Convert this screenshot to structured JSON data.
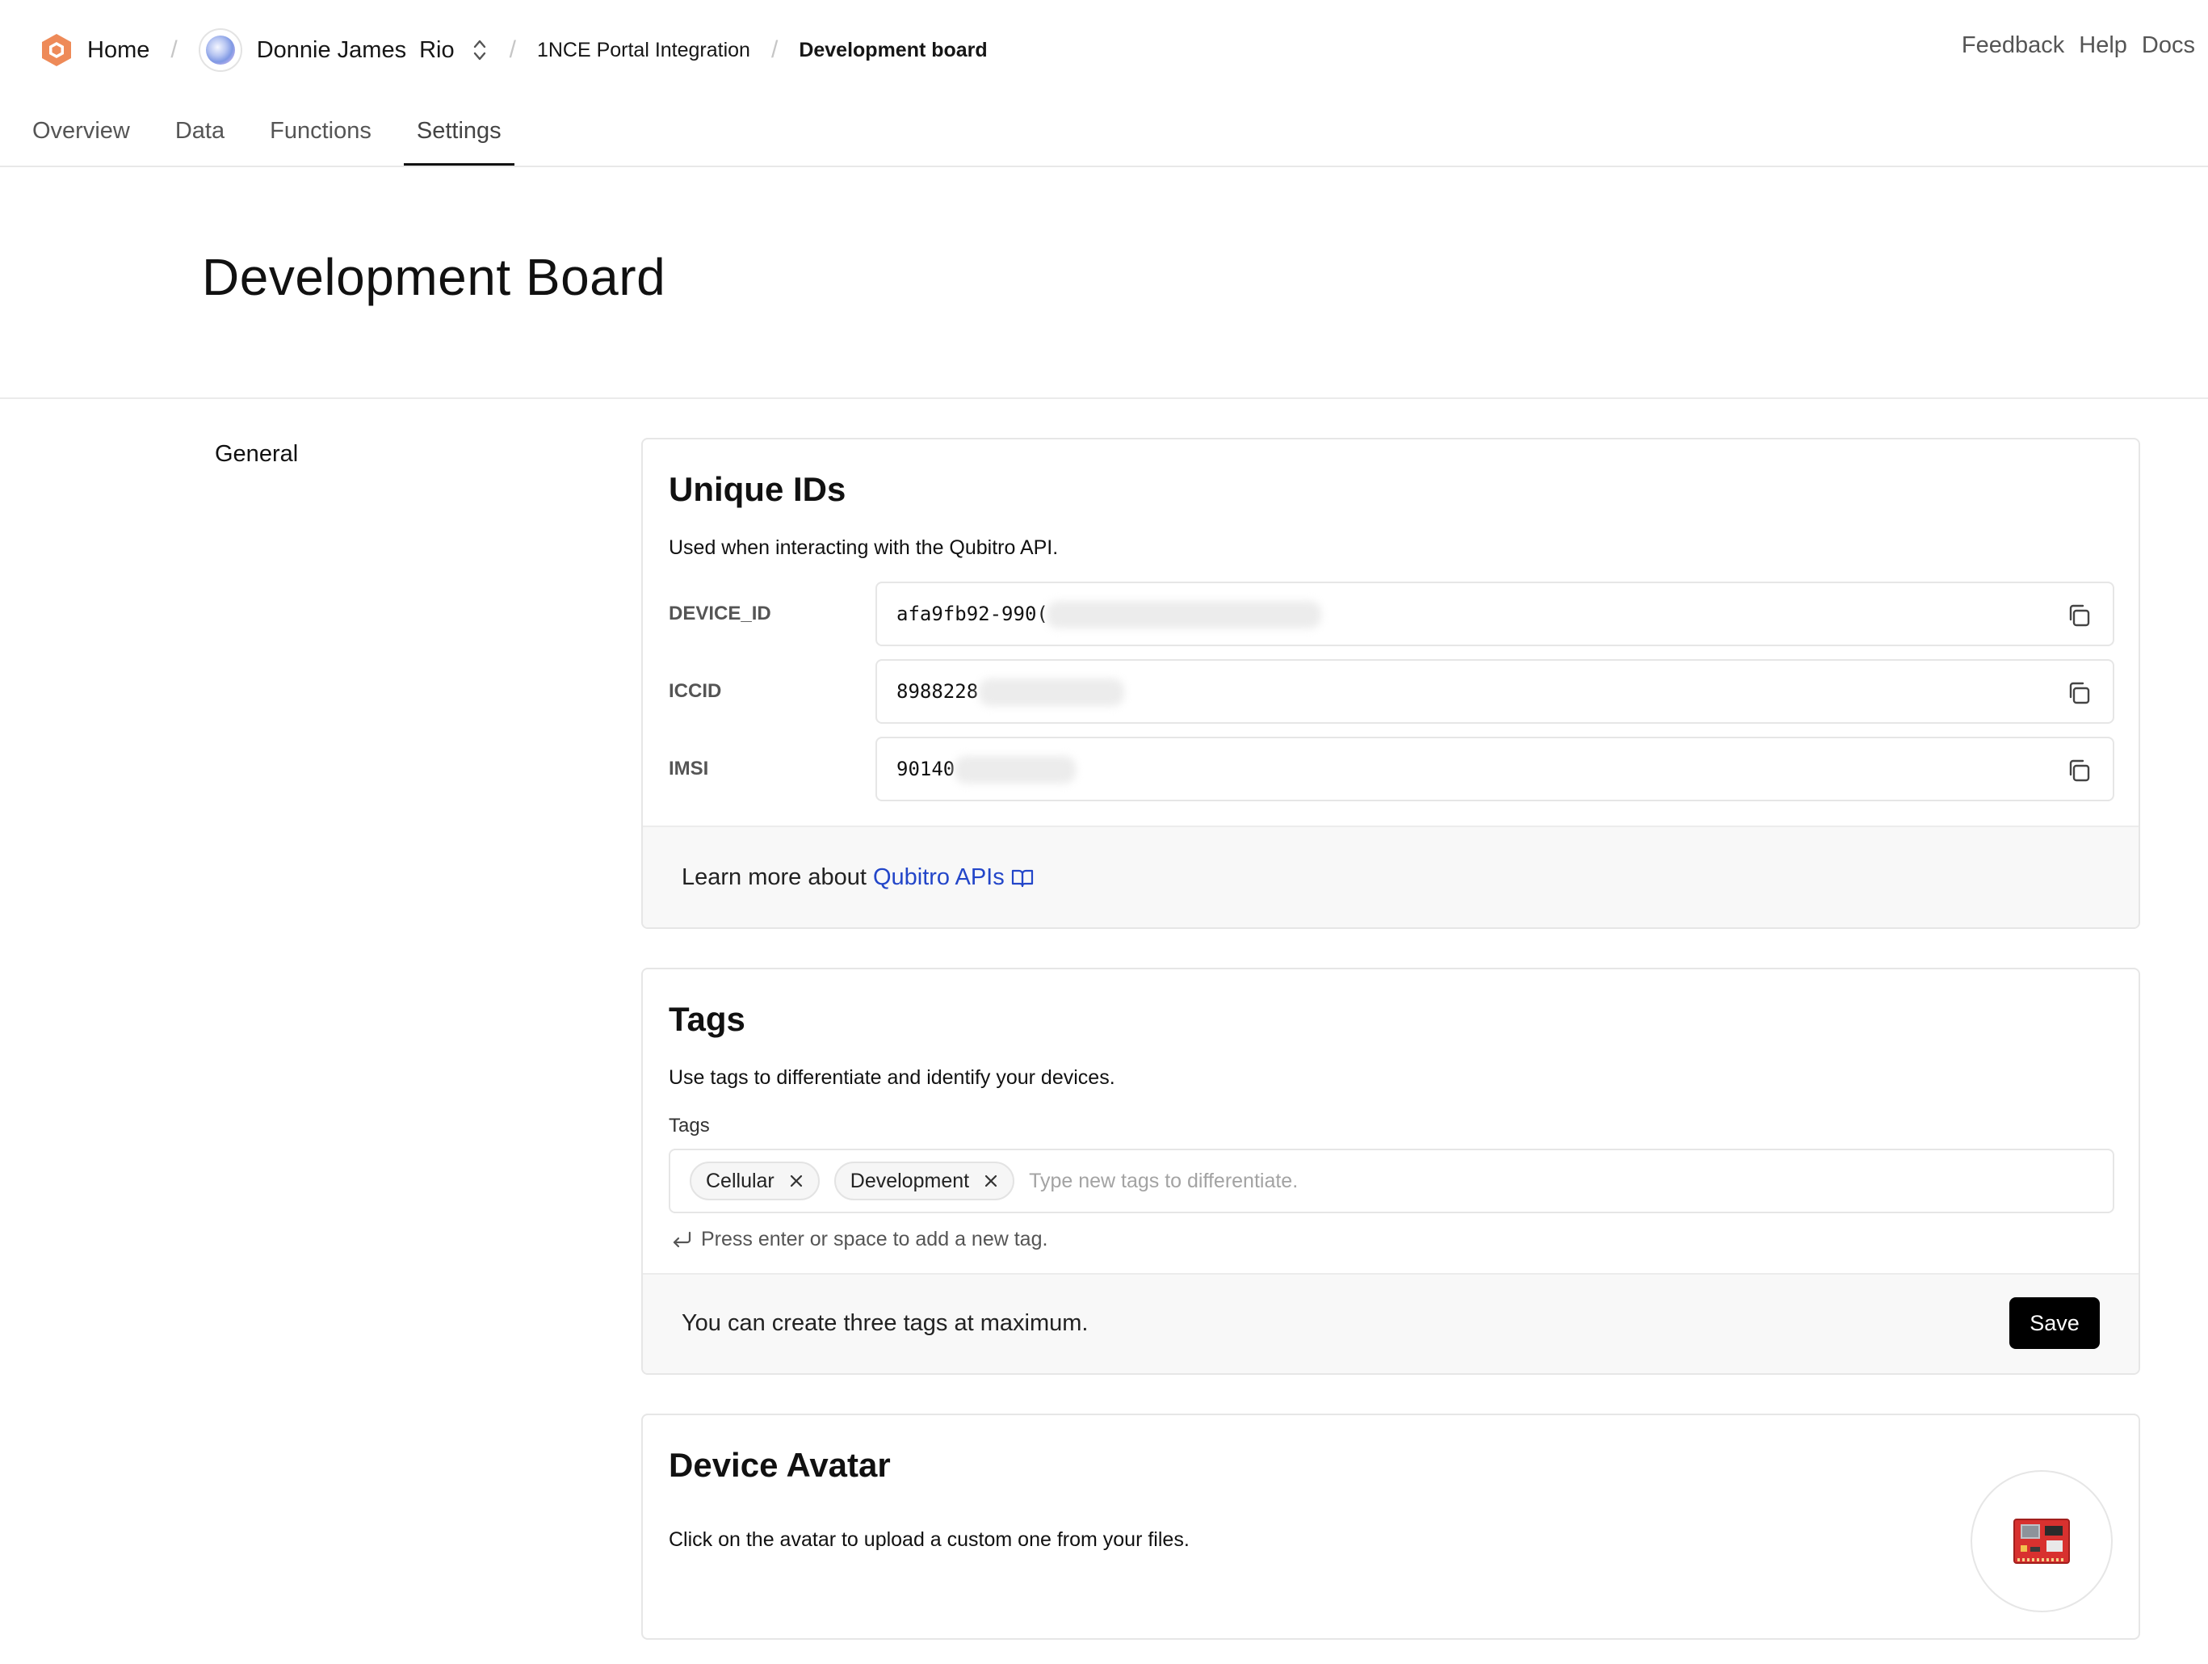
{
  "breadcrumb": {
    "home": "Home",
    "org": "Donnie James",
    "project": "Rio",
    "integration": "1NCE Portal Integration",
    "device": "Development board"
  },
  "top_links": [
    "Feedback",
    "Help",
    "Docs"
  ],
  "tabs": [
    {
      "label": "Overview"
    },
    {
      "label": "Data"
    },
    {
      "label": "Functions"
    },
    {
      "label": "Settings",
      "active": true
    }
  ],
  "page_title": "Development Board",
  "side_nav": {
    "general": "General"
  },
  "unique_ids": {
    "title": "Unique IDs",
    "description": "Used when interacting with the Qubitro API.",
    "rows": [
      {
        "label": "DEVICE_ID",
        "value": "afa9fb92-990("
      },
      {
        "label": "ICCID",
        "value": "8988228"
      },
      {
        "label": "IMSI",
        "value": "90140"
      }
    ],
    "footer_prefix": "Learn more about",
    "footer_link": "Qubitro APIs"
  },
  "tags": {
    "title": "Tags",
    "description": "Use tags to differentiate and identify your devices.",
    "field_label": "Tags",
    "chips": [
      "Cellular",
      "Development"
    ],
    "placeholder": "Type new tags to differentiate.",
    "hint": "Press enter or space to add a new tag.",
    "footer_text": "You can create three tags at maximum.",
    "save_label": "Save"
  },
  "device_avatar": {
    "title": "Device Avatar",
    "description": "Click on the avatar to upload a custom one from your files."
  },
  "colors": {
    "logo_orange": "#ee8a58",
    "link_blue": "#2346c9",
    "board_red": "#d8312f",
    "primary_button": "#000000"
  },
  "icons": {
    "logo": "hexagon-logo-icon",
    "copy": "copy-icon",
    "book": "book-open-icon",
    "remove_chip": "close-icon",
    "enter": "enter-arrow-icon",
    "switcher": "chevron-up-down-icon"
  }
}
